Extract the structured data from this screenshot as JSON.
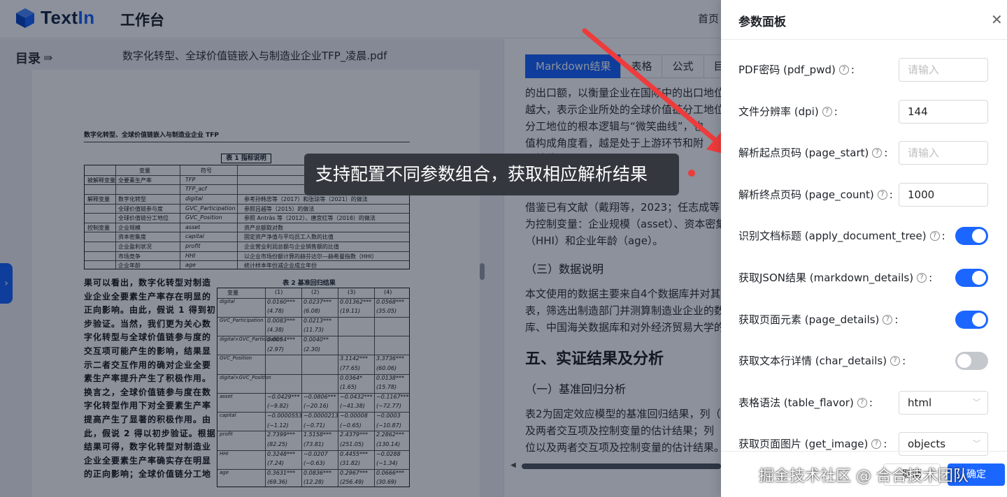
{
  "app": {
    "brand_text": "TextIn",
    "workspace": "工作台",
    "nav_home": "首页"
  },
  "viewer": {
    "toc_label": "目录",
    "file_name": "数字化转型、全球价值链嵌入与制造业企业TFP_凌晨.pdf",
    "page": {
      "header": "数字化转型、全球价值链嵌入与制造业企业 TFP",
      "table1_caption": "表 1 指标说明",
      "table1_headers": [
        "变量",
        "符号",
        "说明"
      ],
      "table1_rows": [
        [
          "被解释变量",
          "全要素生产率",
          "TFP"
        ],
        [
          "",
          "",
          "TFP_acf"
        ],
        [
          "解释变量",
          "数字化转型",
          "digital"
        ],
        [
          "",
          "全球价值链参与度",
          "GVC_Participation"
        ],
        [
          "",
          "全球价值链分工地位",
          "GVC_Position"
        ],
        [
          "控制变量",
          "企业规模",
          "asset"
        ],
        [
          "",
          "资本密集度",
          "capital"
        ],
        [
          "",
          "企业盈利状况",
          "profit"
        ],
        [
          "",
          "市场竞争",
          "HHI"
        ],
        [
          "",
          "企业年龄",
          "age"
        ]
      ],
      "table1_notes": [
        "参考孙韩忠等（2017）和张琼等（2021）的做法",
        "参照吕越等（2015）的做法",
        "参照 Antràs 等（2012）、唐宜红等（2018）的做法",
        "资产总额取对数",
        "固定资产净值与平均员工人数的比值",
        "企业营业利润总额与企业销售额的比值",
        "以企业市场份额计算的赫芬达尔—赫希曼指数（HHI）",
        "统计样本年份减企业成立年份"
      ],
      "body_lines": [
        "果可以看出，数字化转型对制造",
        "业企业全要素生产率存在明显的",
        "正向影响。由此，假说 1 得到初",
        "步验证。当然，我们更为关心数",
        "字化转型与全球价值链参与度的",
        "交互项可能产生的影响，结果显",
        "示二者交互作用的确对企业全要",
        "素生产率提升产生了积极作用。",
        "换言之，全球价值链参与度在数",
        "字化转型作用下对全要素生产率",
        "提高产生了显著的积极作用。由",
        "此，假说 2 得以初步验证。根据",
        "结果可得，数字化转型对制造业",
        "企业全要素生产率确实存在明显",
        "的正向影响；全球价值链分工地"
      ],
      "table2_caption": "表 2 基准回归结果",
      "table2_headers": [
        "变量",
        "(1)",
        "(2)",
        "(3)",
        "(4)"
      ],
      "table2_rows": [
        [
          "digital",
          "0.0160***",
          "0.0237***",
          "0.01362***",
          "0.0568***"
        ],
        [
          "",
          "(4.78)",
          "(6.08)",
          "(19.11)",
          "(35.05)"
        ],
        [
          "GVC_Participation",
          "0.0083***",
          "0.0213***",
          "",
          ""
        ],
        [
          "",
          "(4.38)",
          "(11.73)",
          "",
          ""
        ],
        [
          "digital×GVC_Participation",
          "0.0054***",
          "0.0040**",
          "",
          ""
        ],
        [
          "",
          "(2.97)",
          "(2.30)",
          "",
          ""
        ],
        [
          "GVC_Position",
          "",
          "",
          "3.1142***",
          "3.3736***"
        ],
        [
          "",
          "",
          "",
          "(77.65)",
          "(60.06)"
        ],
        [
          "digital×GVC_Position",
          "",
          "",
          "0.0364*",
          "0.0138***"
        ],
        [
          "",
          "",
          "",
          "(1.65)",
          "(15.78)"
        ],
        [
          "asset",
          "−0.0429***",
          "−0.0806***",
          "−0.0432***",
          "−0.1167***"
        ],
        [
          "",
          "(−9.82)",
          "(−20.16)",
          "(−41.38)",
          "(−72.77)"
        ],
        [
          "capital",
          "−0.0000553",
          "−0.0000213",
          "−0.00008",
          "−0.0003"
        ],
        [
          "",
          "(−1.12)",
          "(−0.71)",
          "(−0.65)",
          "(−10.87)"
        ],
        [
          "profit",
          "2.7399***",
          "1.5158***",
          "2.4379***",
          "2.2862***"
        ],
        [
          "",
          "(82.25)",
          "(73.81)",
          "(251.05)",
          "(130.14)"
        ],
        [
          "HHI",
          "0.3248***",
          "−0.0207",
          "0.4455***",
          "−0.0288"
        ],
        [
          "",
          "(7.24)",
          "(−0.63)",
          "(31.82)",
          "(−1.34)"
        ],
        [
          "age",
          "0.3631***",
          "0.0836***",
          "0.2967***",
          "0.0666***"
        ],
        [
          "",
          "(69.36)",
          "(12.28)",
          "(256.49)",
          "(30.69)"
        ]
      ]
    }
  },
  "result": {
    "tabs": [
      "Markdown结果",
      "表格",
      "公式",
      "目"
    ],
    "active_tab": "Markdown结果",
    "lines": [
      {
        "kind": "p",
        "text": "的出口额，以衡量企业在国际中的出口地位"
      },
      {
        "kind": "p",
        "text": "越大，表示企业所处的全球价值链分工地位"
      },
      {
        "kind": "p",
        "text": "分工地位的根本逻辑与“微笑曲线”，也"
      },
      {
        "kind": "p",
        "text": "值构成角度看，越是处于上游环节和附"
      },
      {
        "kind": "p",
        "text": "工地位"
      },
      {
        "kind": "p",
        "text": "借鉴已有文献（戴翔等，2023；任志成等，"
      },
      {
        "kind": "p",
        "text": "为控制变量：企业规模（asset）、资本密集"
      },
      {
        "kind": "p",
        "text": "（HHI）和企业年龄（age）。"
      },
      {
        "kind": "h3",
        "text": "（三）数据说明"
      },
      {
        "kind": "p",
        "text": "本文使用的数据主要来自4个数据库并对其进"
      },
      {
        "kind": "p",
        "text": "表，筛选出制造部门并测算制造业企业的数"
      },
      {
        "kind": "p",
        "text": "库、中国海关数据库和对外经济贸易大学的"
      },
      {
        "kind": "h2",
        "text": "五、实证结果及分析"
      },
      {
        "kind": "h3",
        "text": "（一）基准回归分析"
      },
      {
        "kind": "p",
        "text": "表2为固定效应模型的基准回归结果，列（1"
      },
      {
        "kind": "p",
        "text": "及两者交互项及控制变量的估计结果；列（"
      },
      {
        "kind": "p",
        "text": "位以及两者交互项及控制变量的估计结果。"
      }
    ]
  },
  "tooltip": {
    "text": "支持配置不同参数组合，获取相应解析结果"
  },
  "panel": {
    "title": "参数面板",
    "rows": [
      {
        "label": "PDF密码 (pdf_pwd)",
        "control": "input",
        "value": "",
        "placeholder": "请输入"
      },
      {
        "label": "文件分辨率 (dpi)",
        "control": "input",
        "value": "144",
        "placeholder": ""
      },
      {
        "label": "解析起点页码 (page_start)",
        "control": "input",
        "value": "",
        "placeholder": "请输入"
      },
      {
        "label": "解析终点页码 (page_count)",
        "control": "input",
        "value": "1000",
        "placeholder": ""
      },
      {
        "label": "识别文档标题 (apply_document_tree)",
        "control": "toggle",
        "on": true
      },
      {
        "label": "获取JSON结果 (markdown_details)",
        "control": "toggle",
        "on": true
      },
      {
        "label": "获取页面元素 (page_details)",
        "control": "toggle",
        "on": true
      },
      {
        "label": "获取文本行详情 (char_details)",
        "control": "toggle",
        "on": false
      },
      {
        "label": "表格语法 (table_flavor)",
        "control": "select",
        "value": "html"
      },
      {
        "label": "获取页面图片 (get_image)",
        "control": "select",
        "value": "objects"
      }
    ],
    "cancel_label": "取消",
    "confirm_label": "确定"
  },
  "watermark": "掘金技术社区 @ 合合技术团队",
  "colors": {
    "accent": "#1b66ff",
    "arrow": "#ee3b3b",
    "tooltip_bg": "#34383e"
  }
}
